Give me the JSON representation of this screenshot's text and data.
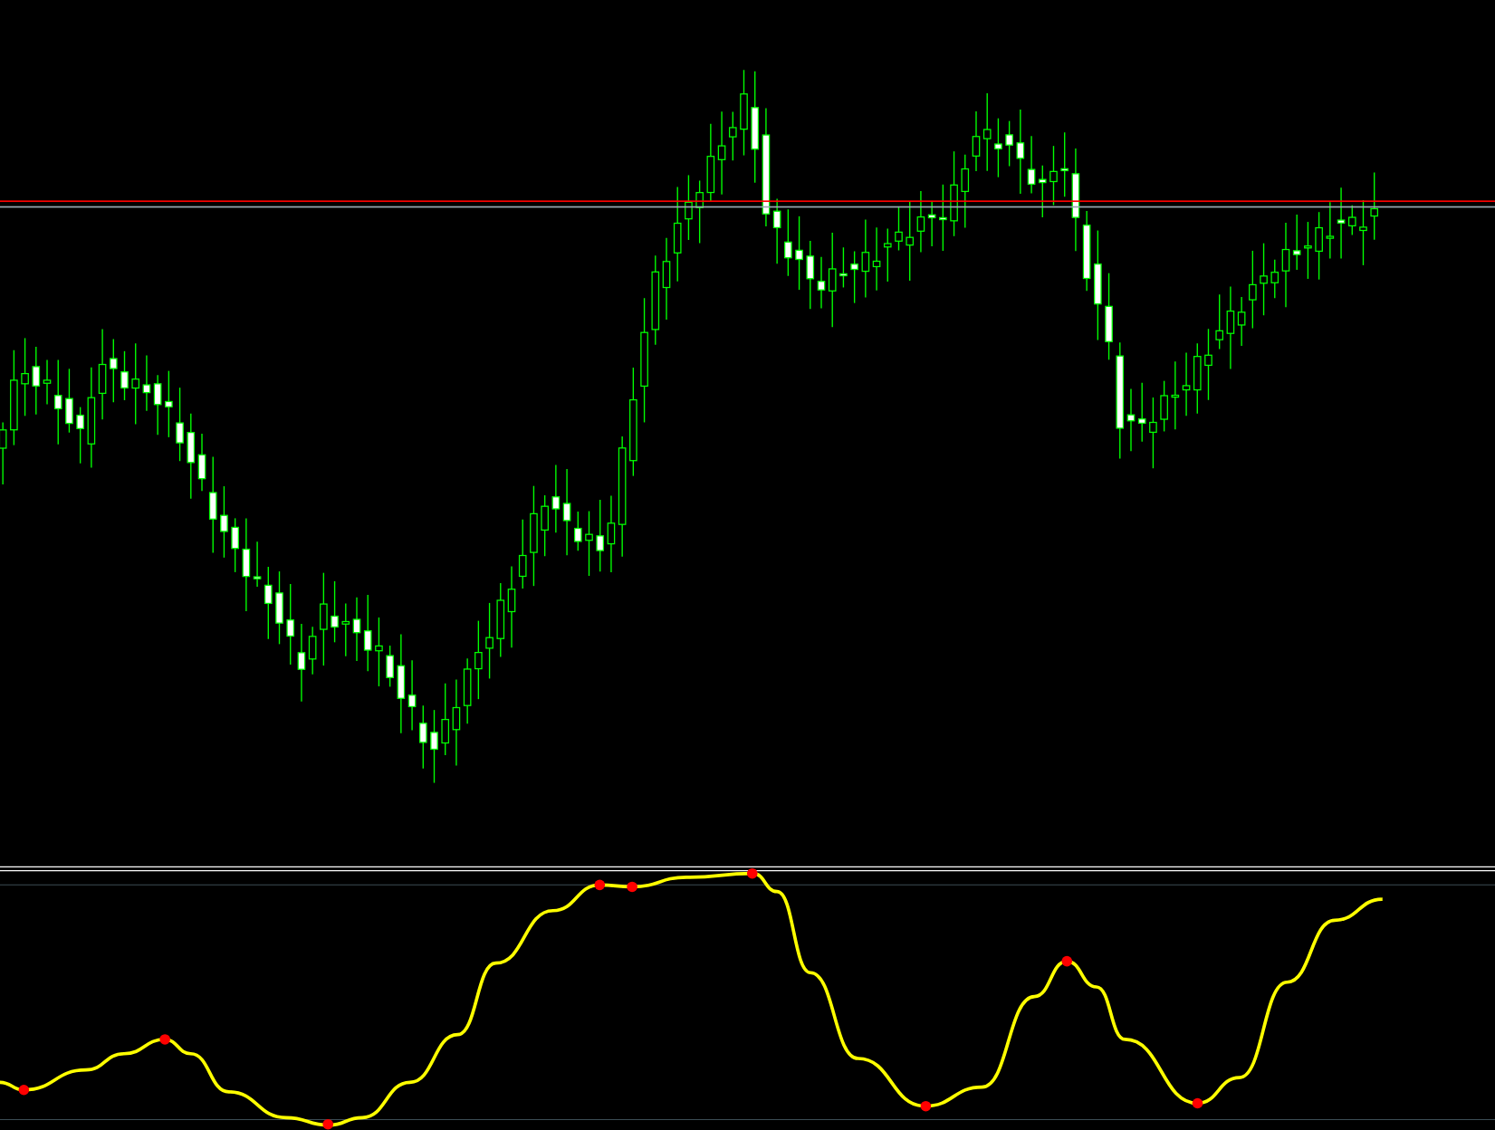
{
  "price_chart": {
    "kind": "candlestick",
    "lines": [
      {
        "kind": "level",
        "color": "#ff0000"
      },
      {
        "kind": "level",
        "color": "#9aa8b0"
      }
    ]
  },
  "indicator": {
    "kind": "oscillator",
    "color": "#ffff00"
  }
}
